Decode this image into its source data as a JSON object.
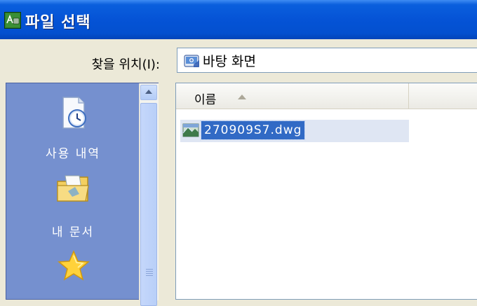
{
  "window": {
    "title": "파일 선택",
    "icon": "autocad-app-icon"
  },
  "lookin": {
    "label": "찾을 위치(I):",
    "value": "바탕 화면",
    "icon": "desktop-folder-icon"
  },
  "places": [
    {
      "label": "사용 내역",
      "icon": "history-clock-icon"
    },
    {
      "label": "내 문서",
      "icon": "my-documents-folder-icon"
    },
    {
      "label": "",
      "icon": "favorites-star-icon"
    }
  ],
  "filelist": {
    "column_name": "이름",
    "sort": "ascending",
    "files": [
      {
        "name": "270909S7.dwg",
        "icon": "dwg-file-icon",
        "selected": true
      }
    ]
  },
  "colors": {
    "titlebar": "#0553d6",
    "places_bg": "#7590cf",
    "selection": "#316ac5"
  }
}
